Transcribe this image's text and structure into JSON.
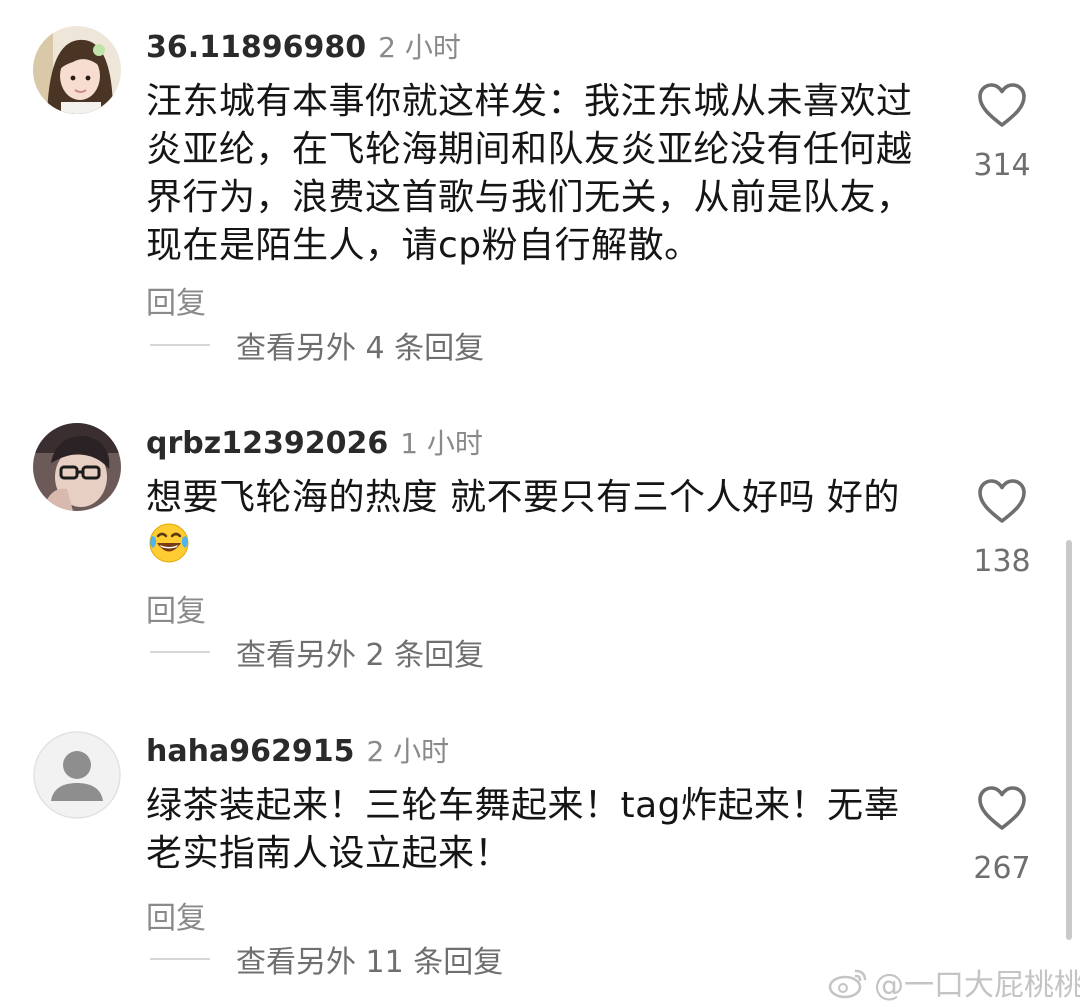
{
  "background_hint": {
    "app_name": "",
    "prompt": "",
    "btn_ok": "",
    "btn_open": ""
  },
  "comments": [
    {
      "username": "36.11896980",
      "time": "2 小时",
      "text": "汪东城有本事你就这样发：我汪东城从未喜欢过炎亚纶，在飞轮海期间和队友炎亚纶没有任何越界行为，浪费这首歌与我们无关，从前是队友，现在是陌生人，请cp粉自行解散。",
      "reply_label": "回复",
      "view_more": "查看另外 4 条回复",
      "likes": "314",
      "avatar": "girl-photo"
    },
    {
      "username": "qrbz12392026",
      "time": "1 小时",
      "text": "想要飞轮海的热度 就不要只有三个人好吗 好的",
      "emoji": "laughing-tears-emoji",
      "reply_label": "回复",
      "view_more": "查看另外 2 条回复",
      "likes": "138",
      "avatar": "glasses-guy-photo"
    },
    {
      "username": "haha962915",
      "time": "2 小时",
      "text": "绿茶装起来！三轮车舞起来！tag炸起来！无辜老实指南人设立起来！",
      "reply_label": "回复",
      "view_more": "查看另外 11 条回复",
      "likes": "267",
      "avatar": "default-user"
    }
  ],
  "watermark": "@一口大屁桃桃",
  "colors": {
    "text": "#151515",
    "secondary": "#8a8a8a",
    "muted": "#6f6f6f"
  }
}
